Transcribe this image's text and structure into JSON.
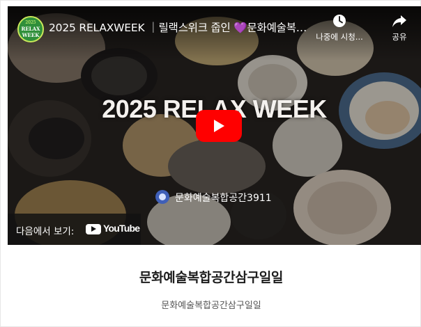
{
  "player": {
    "channel_avatar_text": {
      "line1": "2025",
      "line2": "RELAX",
      "line3": "WEEK"
    },
    "video_title": "2025 RELAXWEEK ｜릴랙스위크 줍인 ",
    "video_title_heart": "💜",
    "video_title_tail": "문화예술복합공간삼구일일",
    "watch_later_label": "나중에 시청...",
    "share_label": "공유",
    "thumbnail_heading": "2025 RELAX WEEK",
    "thumbnail_channel": "문화예술복합공간3911",
    "watch_on_label": "다음에서 보기:",
    "youtube_wordmark": "YouTube",
    "colors": {
      "play_button": "#ff0000",
      "heart": "#9a6cf5"
    },
    "icons": [
      "clock-icon",
      "share-arrow-icon",
      "play-icon",
      "youtube-logo-icon"
    ]
  },
  "card": {
    "title": "문화예술복합공간삼구일일",
    "subtitle": "문화예술복합공간삼구일일"
  }
}
